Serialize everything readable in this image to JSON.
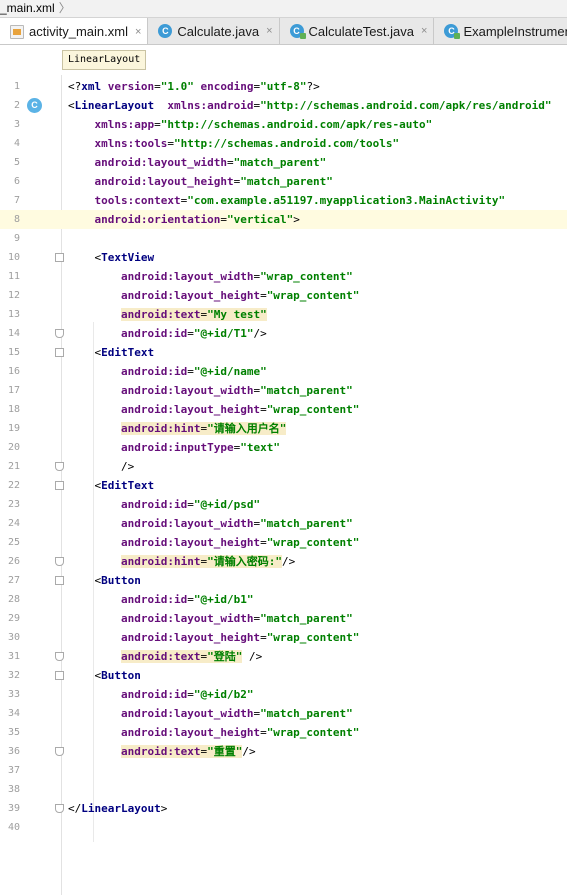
{
  "breadcrumb": {
    "file": "_main.xml",
    "separator": "〉"
  },
  "tabs": [
    {
      "label": "activity_main.xml",
      "icon": "xml-file-icon",
      "close": "×"
    },
    {
      "label": "Calculate.java",
      "icon": "java-class-icon",
      "close": "×"
    },
    {
      "label": "CalculateTest.java",
      "icon": "java-test-class-icon",
      "close": "×"
    },
    {
      "label": "ExampleInstrument",
      "icon": "java-test-class-icon",
      "close": ""
    }
  ],
  "tooltip": "LinearLayout",
  "gutter_icon": "C",
  "lines": [
    {
      "n": "1",
      "parts": [
        [
          "p",
          "<?"
        ],
        [
          "t",
          "xml "
        ],
        [
          "a",
          "version"
        ],
        [
          "p",
          "="
        ],
        [
          "v",
          "\"1.0\" "
        ],
        [
          "a",
          "encoding"
        ],
        [
          "p",
          "="
        ],
        [
          "v",
          "\"utf-8\""
        ],
        [
          "p",
          "?>"
        ]
      ]
    },
    {
      "n": "2",
      "parts": [
        [
          "p",
          "<"
        ],
        [
          "t",
          "LinearLayout  "
        ],
        [
          "a",
          "xmlns:android"
        ],
        [
          "p",
          "="
        ],
        [
          "v",
          "\"http://schemas.android.com/apk/res/android\""
        ]
      ]
    },
    {
      "n": "3",
      "parts": [
        [
          "p",
          "    "
        ],
        [
          "a",
          "xmlns:app"
        ],
        [
          "p",
          "="
        ],
        [
          "v",
          "\"http://schemas.android.com/apk/res-auto\""
        ]
      ]
    },
    {
      "n": "4",
      "parts": [
        [
          "p",
          "    "
        ],
        [
          "a",
          "xmlns:tools"
        ],
        [
          "p",
          "="
        ],
        [
          "v",
          "\"http://schemas.android.com/tools\""
        ]
      ]
    },
    {
      "n": "5",
      "parts": [
        [
          "p",
          "    "
        ],
        [
          "a",
          "android:layout_width"
        ],
        [
          "p",
          "="
        ],
        [
          "v",
          "\"match_parent\""
        ]
      ]
    },
    {
      "n": "6",
      "parts": [
        [
          "p",
          "    "
        ],
        [
          "a",
          "android:layout_height"
        ],
        [
          "p",
          "="
        ],
        [
          "v",
          "\"match_parent\""
        ]
      ]
    },
    {
      "n": "7",
      "parts": [
        [
          "p",
          "    "
        ],
        [
          "a",
          "tools:context"
        ],
        [
          "p",
          "="
        ],
        [
          "v",
          "\"com.example.a51197.myapplication3.MainActivity\""
        ]
      ]
    },
    {
      "n": "8",
      "parts": [
        [
          "p",
          "    "
        ],
        [
          "a",
          "android:orientation"
        ],
        [
          "p",
          "="
        ],
        [
          "v",
          "\"vertical\""
        ],
        [
          "p",
          ">"
        ]
      ]
    },
    {
      "n": "9",
      "parts": []
    },
    {
      "n": "10",
      "parts": [
        [
          "p",
          "    <"
        ],
        [
          "t",
          "TextView"
        ]
      ]
    },
    {
      "n": "11",
      "parts": [
        [
          "p",
          "        "
        ],
        [
          "a",
          "android:layout_width"
        ],
        [
          "p",
          "="
        ],
        [
          "v",
          "\"wrap_content\""
        ]
      ]
    },
    {
      "n": "12",
      "parts": [
        [
          "p",
          "        "
        ],
        [
          "a",
          "android:layout_height"
        ],
        [
          "p",
          "="
        ],
        [
          "v",
          "\"wrap_content\""
        ]
      ]
    },
    {
      "n": "13",
      "parts": [
        [
          "p",
          "        "
        ],
        [
          "ha",
          "android:text"
        ],
        [
          "hp",
          "="
        ],
        [
          "hv",
          "\"My test\""
        ]
      ]
    },
    {
      "n": "14",
      "parts": [
        [
          "p",
          "        "
        ],
        [
          "a",
          "android:id"
        ],
        [
          "p",
          "="
        ],
        [
          "v",
          "\"@+id/T1\""
        ],
        [
          "p",
          "/>"
        ]
      ]
    },
    {
      "n": "15",
      "parts": [
        [
          "p",
          "    <"
        ],
        [
          "t",
          "EditText"
        ]
      ]
    },
    {
      "n": "16",
      "parts": [
        [
          "p",
          "        "
        ],
        [
          "a",
          "android:id"
        ],
        [
          "p",
          "="
        ],
        [
          "v",
          "\"@+id/name\""
        ]
      ]
    },
    {
      "n": "17",
      "parts": [
        [
          "p",
          "        "
        ],
        [
          "a",
          "android:layout_width"
        ],
        [
          "p",
          "="
        ],
        [
          "v",
          "\"match_parent\""
        ]
      ]
    },
    {
      "n": "18",
      "parts": [
        [
          "p",
          "        "
        ],
        [
          "a",
          "android:layout_height"
        ],
        [
          "p",
          "="
        ],
        [
          "v",
          "\"wrap_content\""
        ]
      ]
    },
    {
      "n": "19",
      "parts": [
        [
          "p",
          "        "
        ],
        [
          "ha",
          "android:hint"
        ],
        [
          "hp",
          "="
        ],
        [
          "hv",
          "\"请输入用户名\""
        ]
      ]
    },
    {
      "n": "20",
      "parts": [
        [
          "p",
          "        "
        ],
        [
          "a",
          "android:inputType"
        ],
        [
          "p",
          "="
        ],
        [
          "v",
          "\"text\""
        ]
      ]
    },
    {
      "n": "21",
      "parts": [
        [
          "p",
          "        />"
        ]
      ]
    },
    {
      "n": "22",
      "parts": [
        [
          "p",
          "    <"
        ],
        [
          "t",
          "EditText"
        ]
      ]
    },
    {
      "n": "23",
      "parts": [
        [
          "p",
          "        "
        ],
        [
          "a",
          "android:id"
        ],
        [
          "p",
          "="
        ],
        [
          "v",
          "\"@+id/psd\""
        ]
      ]
    },
    {
      "n": "24",
      "parts": [
        [
          "p",
          "        "
        ],
        [
          "a",
          "android:layout_width"
        ],
        [
          "p",
          "="
        ],
        [
          "v",
          "\"match_parent\""
        ]
      ]
    },
    {
      "n": "25",
      "parts": [
        [
          "p",
          "        "
        ],
        [
          "a",
          "android:layout_height"
        ],
        [
          "p",
          "="
        ],
        [
          "v",
          "\"wrap_content\""
        ]
      ]
    },
    {
      "n": "26",
      "parts": [
        [
          "p",
          "        "
        ],
        [
          "ha",
          "android:hint"
        ],
        [
          "hp",
          "="
        ],
        [
          "hv",
          "\"请输入密码:\""
        ],
        [
          "p",
          "/>"
        ]
      ]
    },
    {
      "n": "27",
      "parts": [
        [
          "p",
          "    <"
        ],
        [
          "t",
          "Button"
        ]
      ]
    },
    {
      "n": "28",
      "parts": [
        [
          "p",
          "        "
        ],
        [
          "a",
          "android:id"
        ],
        [
          "p",
          "="
        ],
        [
          "v",
          "\"@+id/b1\""
        ]
      ]
    },
    {
      "n": "29",
      "parts": [
        [
          "p",
          "        "
        ],
        [
          "a",
          "android:layout_width"
        ],
        [
          "p",
          "="
        ],
        [
          "v",
          "\"match_parent\""
        ]
      ]
    },
    {
      "n": "30",
      "parts": [
        [
          "p",
          "        "
        ],
        [
          "a",
          "android:layout_height"
        ],
        [
          "p",
          "="
        ],
        [
          "v",
          "\"wrap_content\""
        ]
      ]
    },
    {
      "n": "31",
      "parts": [
        [
          "p",
          "        "
        ],
        [
          "ha",
          "android:text"
        ],
        [
          "hp",
          "="
        ],
        [
          "hv",
          "\"登陆\""
        ],
        [
          "p",
          " />"
        ]
      ]
    },
    {
      "n": "32",
      "parts": [
        [
          "p",
          "    <"
        ],
        [
          "t",
          "Button"
        ]
      ]
    },
    {
      "n": "33",
      "parts": [
        [
          "p",
          "        "
        ],
        [
          "a",
          "android:id"
        ],
        [
          "p",
          "="
        ],
        [
          "v",
          "\"@+id/b2\""
        ]
      ]
    },
    {
      "n": "34",
      "parts": [
        [
          "p",
          "        "
        ],
        [
          "a",
          "android:layout_width"
        ],
        [
          "p",
          "="
        ],
        [
          "v",
          "\"match_parent\""
        ]
      ]
    },
    {
      "n": "35",
      "parts": [
        [
          "p",
          "        "
        ],
        [
          "a",
          "android:layout_height"
        ],
        [
          "p",
          "="
        ],
        [
          "v",
          "\"wrap_content\""
        ]
      ]
    },
    {
      "n": "36",
      "parts": [
        [
          "p",
          "        "
        ],
        [
          "ha",
          "android:text"
        ],
        [
          "hp",
          "="
        ],
        [
          "hv",
          "\"重置\""
        ],
        [
          "p",
          "/>"
        ]
      ]
    },
    {
      "n": "37",
      "parts": []
    },
    {
      "n": "38",
      "parts": []
    },
    {
      "n": "39",
      "parts": [
        [
          "p",
          "</"
        ],
        [
          "t",
          "LinearLayout"
        ],
        [
          "p",
          ">"
        ]
      ]
    },
    {
      "n": "40",
      "parts": []
    }
  ]
}
